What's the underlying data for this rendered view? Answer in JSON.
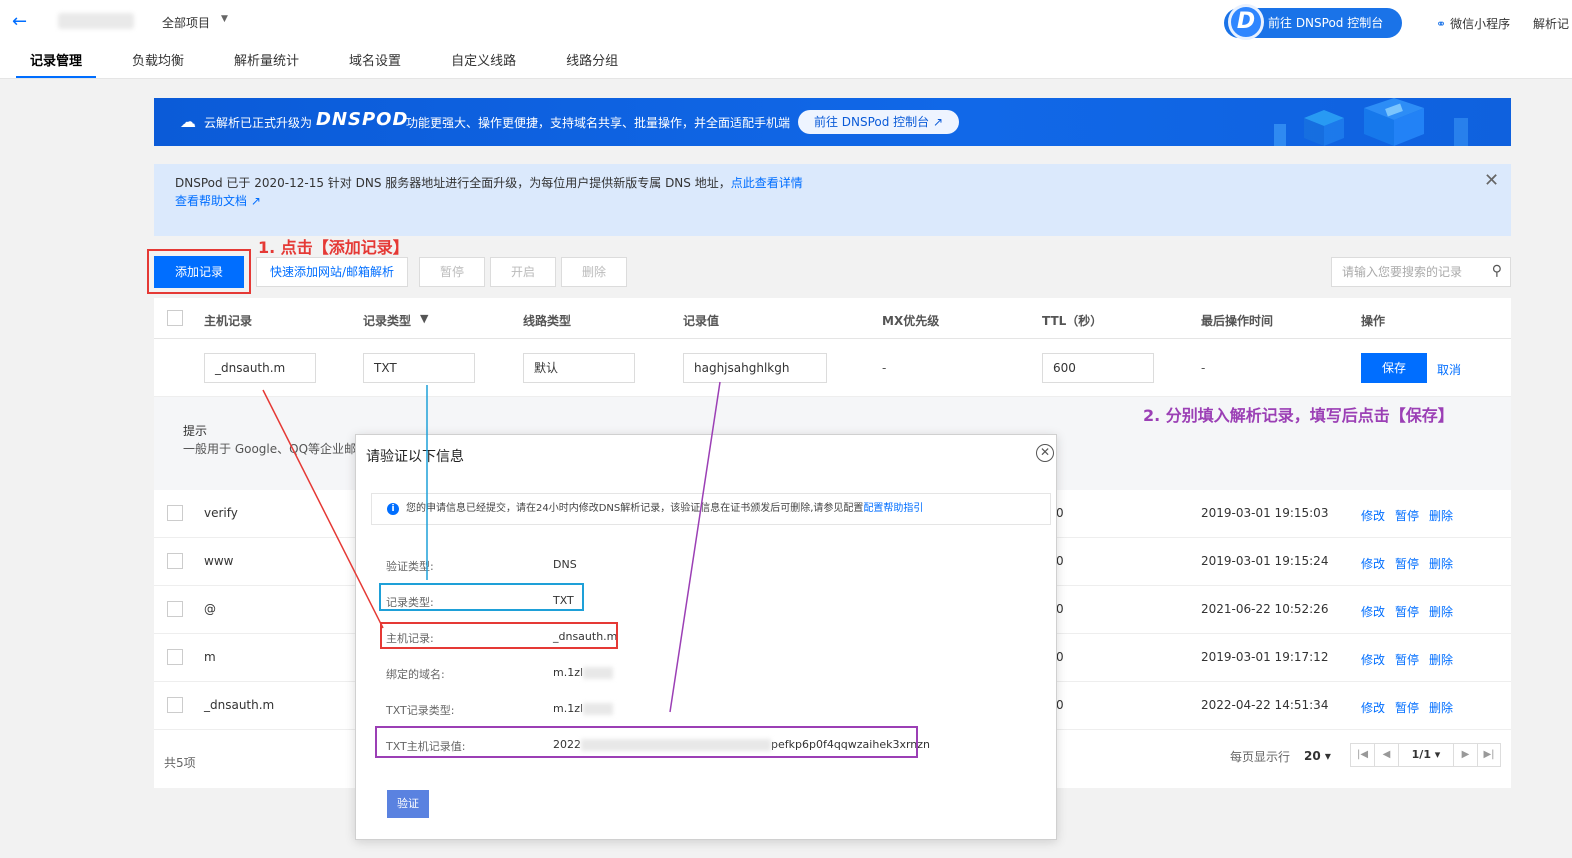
{
  "header": {
    "project_label": "全部项目",
    "dnspod_button": "前往 DNSPod 控制台",
    "dnspod_logo": "D",
    "mini_program": "微信小程序",
    "parse_label": "解析记"
  },
  "tabs": [
    "记录管理",
    "负载均衡",
    "解析量统计",
    "域名设置",
    "自定义线路",
    "线路分组"
  ],
  "banner": {
    "text1": "云解析已正式升级为",
    "logo": "DNSPOD",
    "text2": "功能更强大、操作更便捷，支持域名共享、批量操作，并全面适配手机端",
    "button": "前往 DNSPod 控制台 ↗"
  },
  "notice": {
    "line1": "DNSPod 已于 2020-12-15 针对 DNS 服务器地址进行全面升级，为每位用户提供新版专属 DNS 地址，",
    "link1": "点此查看详情",
    "line2": "查看帮助文档 ↗"
  },
  "toolbar": {
    "add": "添加记录",
    "quick_add": "快速添加网站/邮箱解析",
    "pause": "暂停",
    "enable": "开启",
    "delete": "删除",
    "search_placeholder": "请输入您要搜索的记录"
  },
  "annotations": {
    "step1": "1. 点击【添加记录】",
    "step2": "2. 分别填入解析记录，填写后点击【保存】"
  },
  "table": {
    "headers": [
      "主机记录",
      "记录类型",
      "线路类型",
      "记录值",
      "MX优先级",
      "TTL（秒）",
      "最后操作时间",
      "操作"
    ],
    "edit_row": {
      "host": "_dnsauth.m",
      "type": "TXT",
      "line": "默认",
      "value": "haghjsahghlkgh",
      "mx": "-",
      "ttl": "600",
      "time": "-",
      "save": "保存",
      "cancel": "取消"
    },
    "tips_title": "提示",
    "tips_desc": "一般用于 Google、QQ等企业邮",
    "rows": [
      {
        "host": "verify",
        "ttl": "0",
        "time": "2019-03-01 19:15:03"
      },
      {
        "host": "www",
        "ttl": "0",
        "time": "2019-03-01 19:15:24"
      },
      {
        "host": "@",
        "ttl": "0",
        "time": "2021-06-22 10:52:26"
      },
      {
        "host": "m",
        "ttl": "0",
        "time": "2019-03-01 19:17:12"
      },
      {
        "host": "_dnsauth.m",
        "ttl": "0",
        "time": "2022-04-22 14:51:34"
      }
    ],
    "ops": [
      "修改",
      "暂停",
      "删除"
    ],
    "total": "共5项",
    "per_page_label": "每页显示行",
    "per_page": "20 ▾",
    "page": "1/1 ▾"
  },
  "modal": {
    "title": "请验证以下信息",
    "info": "您的申请信息已经提交，请在24小时内修改DNS解析记录，该验证信息在证书颁发后可删除,请参见配置",
    "info_link": "配置帮助指引",
    "rows": [
      {
        "key": "验证类型:",
        "value": "DNS"
      },
      {
        "key": "记录类型:",
        "value": "TXT"
      },
      {
        "key": "主机记录:",
        "value": "_dnsauth.m"
      },
      {
        "key": "绑定的域名:",
        "value": "m.1zl"
      },
      {
        "key": "TXT记录类型:",
        "value": "m.1zl"
      },
      {
        "key": "TXT主机记录值:",
        "value": "2022",
        "value_tail": "pefkp6p0f4qqwzaihek3xrnzn"
      }
    ],
    "verify": "验证"
  },
  "colors": {
    "primary": "#006eff",
    "red": "#e53935",
    "blue_annot": "#1ea0d8",
    "purple": "#9b3fb5"
  }
}
